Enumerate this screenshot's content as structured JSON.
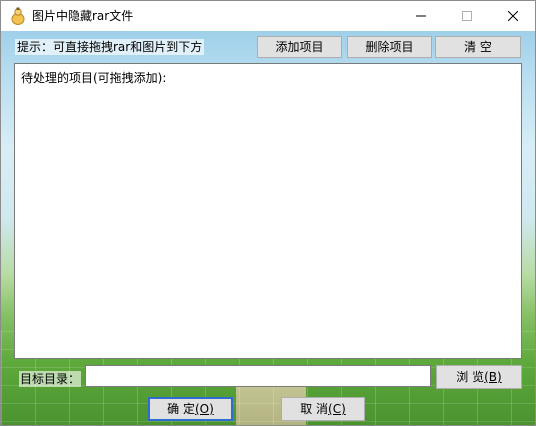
{
  "window": {
    "title": "图片中隐藏rar文件",
    "icon": "app-icon"
  },
  "toolbar": {
    "hint": "提示：可直接拖拽rar和图片到下方",
    "add_label": "添加项目",
    "delete_label": "删除项目",
    "clear_label": "清 空"
  },
  "list": {
    "header": "待处理的项目(可拖拽添加):",
    "items": []
  },
  "target": {
    "label": "目标目录：",
    "value": "",
    "browse_label": "浏 览",
    "browse_mnemonic": "(B)"
  },
  "actions": {
    "ok_label": "确 定",
    "ok_mnemonic": "(O)",
    "cancel_label": "取 消",
    "cancel_mnemonic": "(C)"
  },
  "colors": {
    "focus_border": "#2f6bd0",
    "button_face": "#e1e1e1"
  }
}
